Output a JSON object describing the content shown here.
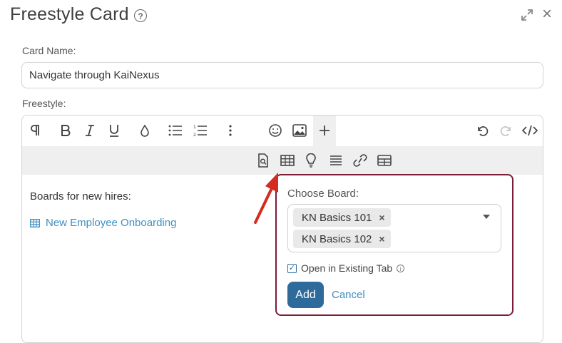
{
  "header": {
    "title": "Freestyle Card",
    "help_icon": "?",
    "close_icon": "×"
  },
  "card_name": {
    "label": "Card Name:",
    "value": "Navigate through KaiNexus"
  },
  "freestyle": {
    "label": "Freestyle:",
    "toolbar_row1": [
      "paragraph-icon",
      "bold-icon",
      "italic-icon",
      "underline-icon",
      "color-drop-icon",
      "bullet-list-icon",
      "numbered-list-icon",
      "more-vertical-icon",
      "emoji-icon",
      "image-icon",
      "plus-icon",
      "undo-icon",
      "redo-icon",
      "code-view-icon"
    ],
    "toolbar_row2": [
      "document-search-icon",
      "board-grid-icon",
      "lightbulb-icon",
      "align-icon",
      "link-icon",
      "table-icon"
    ],
    "content_text": "Boards for new hires:",
    "board_link": "New Employee Onboarding"
  },
  "popup": {
    "label": "Choose Board:",
    "selected_boards": [
      "KN Basics 101",
      "KN Basics 102"
    ],
    "remove_symbol": "×",
    "checkbox_label": "Open in Existing Tab",
    "checkbox_checked": true,
    "info_symbol": "i",
    "add_label": "Add",
    "cancel_label": "Cancel"
  },
  "colors": {
    "accent_border": "#7a1d37",
    "primary_button": "#2e6a9a",
    "link": "#3d8fc1",
    "arrow": "#d42a20"
  }
}
